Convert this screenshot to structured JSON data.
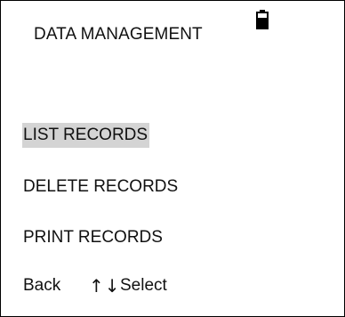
{
  "header": {
    "title": "DATA MANAGEMENT",
    "battery_icon": "battery-icon"
  },
  "menu": {
    "items": [
      {
        "label": "LIST RECORDS",
        "selected": true
      },
      {
        "label": "DELETE RECORDS",
        "selected": false
      },
      {
        "label": "PRINT RECORDS",
        "selected": false
      }
    ]
  },
  "softkeys": {
    "back": "Back",
    "arrows": "↑↓",
    "select": "Select"
  },
  "colors": {
    "selection_highlight": "#d4d4d4",
    "text": "#111111",
    "border": "#000000"
  }
}
